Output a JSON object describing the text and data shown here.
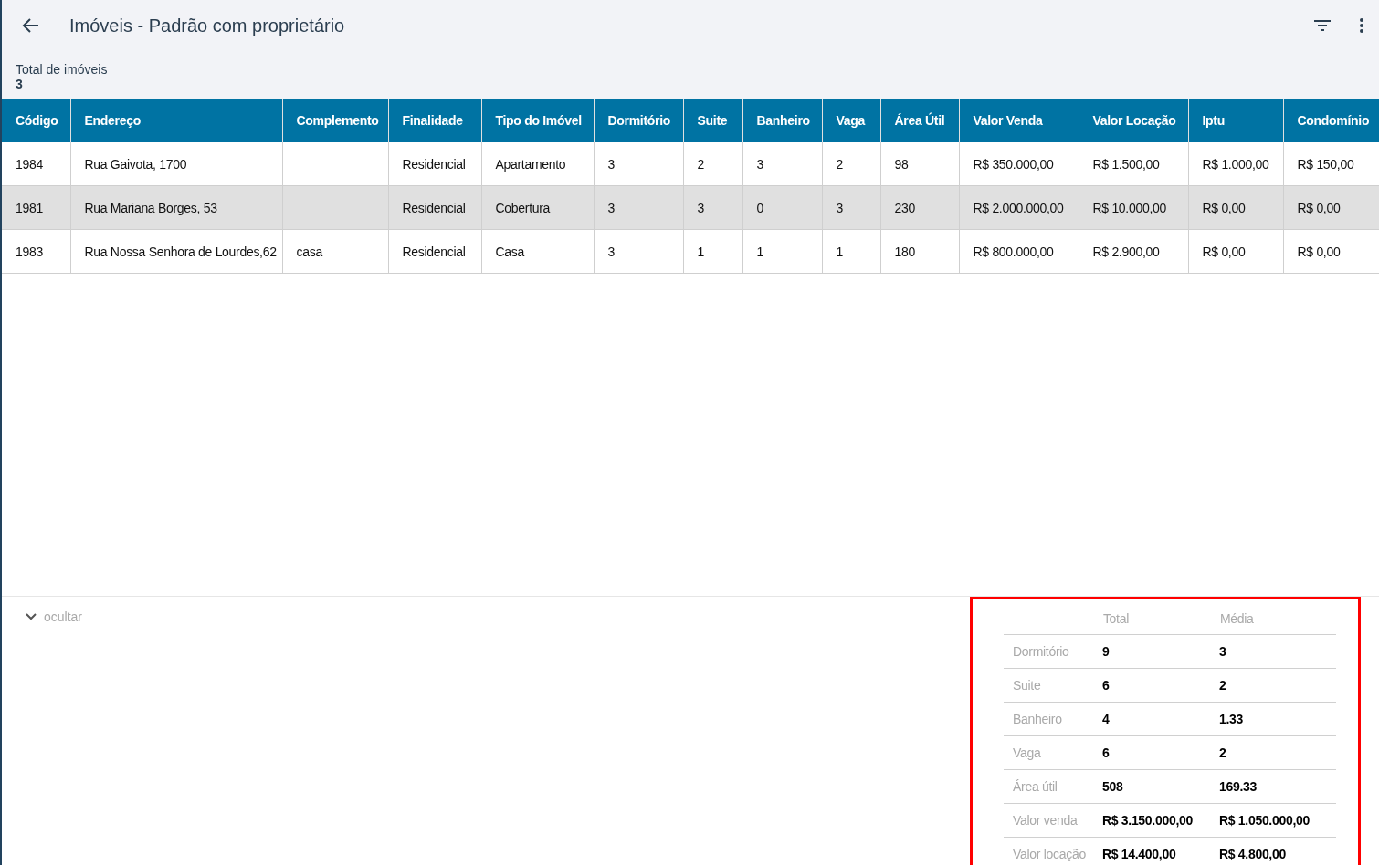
{
  "app_bar": {
    "title": "Imóveis - Padrão com proprietário"
  },
  "total": {
    "label": "Total de imóveis",
    "value": "3"
  },
  "table": {
    "columns": [
      "Código",
      "Endereço",
      "Complemento",
      "Finalidade",
      "Tipo do Imóvel",
      "Dormitório",
      "Suite",
      "Banheiro",
      "Vaga",
      "Área Útil",
      "Valor Venda",
      "Valor Locação",
      "Iptu",
      "Condomínio"
    ],
    "rows": [
      {
        "selected": false,
        "cells": [
          "1984",
          "Rua Gaivota, 1700",
          "",
          "Residencial",
          "Apartamento",
          "3",
          "2",
          "3",
          "2",
          "98",
          "R$ 350.000,00",
          "R$ 1.500,00",
          "R$ 1.000,00",
          "R$ 150,00"
        ]
      },
      {
        "selected": true,
        "cells": [
          "1981",
          "Rua Mariana Borges, 53",
          "",
          "Residencial",
          "Cobertura",
          "3",
          "3",
          "0",
          "3",
          "230",
          "R$ 2.000.000,00",
          "R$ 10.000,00",
          "R$ 0,00",
          "R$ 0,00"
        ]
      },
      {
        "selected": false,
        "cells": [
          "1983",
          "Rua Nossa Senhora de Lourdes,62",
          "casa",
          "Residencial",
          "Casa",
          "3",
          "1",
          "1",
          "1",
          "180",
          "R$ 800.000,00",
          "R$ 2.900,00",
          "R$ 0,00",
          "R$ 0,00"
        ]
      }
    ]
  },
  "footer": {
    "toggle": {
      "label": "ocultar",
      "expanded": true
    }
  },
  "summary": {
    "columns": [
      "Total",
      "Média"
    ],
    "rows": [
      {
        "label": "Dormitório",
        "total": "9",
        "average": "3"
      },
      {
        "label": "Suite",
        "total": "6",
        "average": "2"
      },
      {
        "label": "Banheiro",
        "total": "4",
        "average": "1.33"
      },
      {
        "label": "Vaga",
        "total": "6",
        "average": "2"
      },
      {
        "label": "Área útil",
        "total": "508",
        "average": "169.33"
      },
      {
        "label": "Valor venda",
        "total": "R$ 3.150.000,00",
        "average": "R$ 1.050.000,00"
      },
      {
        "label": "Valor locação",
        "total": "R$ 14.400,00",
        "average": "R$ 4.800,00"
      }
    ]
  }
}
